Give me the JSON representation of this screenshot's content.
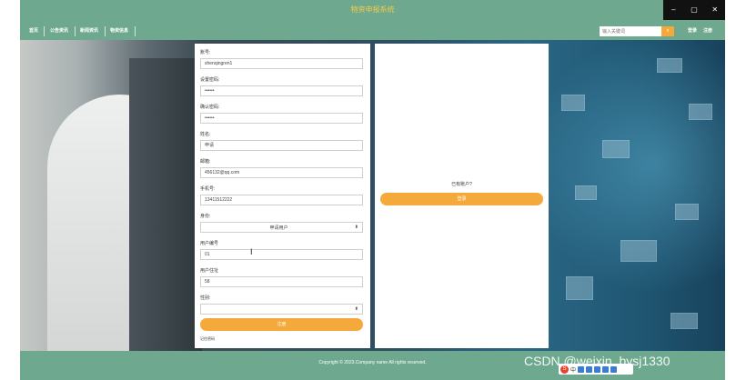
{
  "window": {
    "title": "物资申报系统",
    "controls": {
      "minimize": "–",
      "maximize": "▢",
      "close": "✕"
    }
  },
  "nav": {
    "items": [
      "首页",
      "公告资讯",
      "新闻资讯",
      "物资信息"
    ],
    "search_placeholder": "输入关键词",
    "search_icon": "search-icon",
    "login": "登录",
    "register": "注册"
  },
  "form": {
    "fields": [
      {
        "label": "账号:",
        "value": "shenqingren1"
      },
      {
        "label": "设置密码:",
        "value": "••••••"
      },
      {
        "label": "确认密码:",
        "value": "••••••"
      },
      {
        "label": "姓名:",
        "value": "申请"
      },
      {
        "label": "邮箱:",
        "value": "456132@qq.com"
      },
      {
        "label": "手机号:",
        "value": "13411512222"
      },
      {
        "label": "身份:",
        "value": "申请用户",
        "type": "select"
      },
      {
        "label": "用户编号",
        "value": "01"
      },
      {
        "label": "用户住址",
        "value": "58"
      },
      {
        "label": "性别:",
        "value": "",
        "type": "select"
      }
    ],
    "register_button": "注册",
    "remember": "记住密码"
  },
  "side": {
    "has_account": "已有账户?",
    "login_button": "登录"
  },
  "footer": {
    "copyright": "Copyright © 2023.Company name All rights reserved.",
    "watermark": "CSDN @weixin_bysj1330",
    "ime_text": "中"
  },
  "colors": {
    "header": "#6ea98f",
    "accent": "#f5a93b",
    "title_text": "#f2c94c"
  }
}
